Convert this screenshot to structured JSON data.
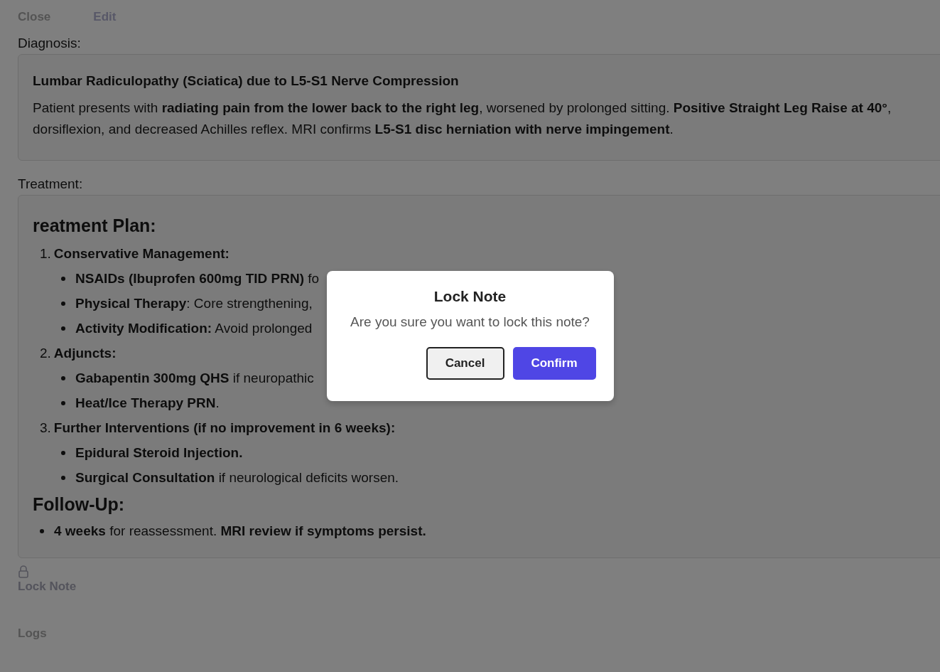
{
  "top_actions": [
    {
      "kind": "close",
      "label": "Close"
    },
    {
      "kind": "edit",
      "label": "Edit"
    }
  ],
  "diagnosis": {
    "label": "Diagnosis:",
    "title": "Lumbar Radiculopathy (Sciatica) due to L5-S1 Nerve Compression",
    "lines": [
      "Patient presents with **radiating pain from the lower back to the right leg**, worsened by prolonged sitting. **Positive Straight Leg Raise at 40°**,",
      "dorsiflexion, and decreased Achilles reflex. MRI confirms **L5-S1 disc herniation with nerve impingement**."
    ]
  },
  "treatment": {
    "label": "Treatment:",
    "blocks": [
      {
        "kind": "heading",
        "text": "reatment Plan:"
      },
      {
        "kind": "numbered",
        "number": "1.",
        "text": "Conservative Management:",
        "children": [
          {
            "text": "**NSAIDs (Ibuprofen 600mg TID PRN)** fo"
          },
          {
            "text": "**Physical Therapy**: Core strengthening,"
          },
          {
            "text": "**Activity Modification:** Avoid prolonged"
          }
        ]
      },
      {
        "kind": "numbered",
        "number": "2.",
        "text": "Adjuncts:",
        "children": [
          {
            "text": "**Gabapentin 300mg QHS** if neuropathic"
          },
          {
            "text": "**Heat/Ice Therapy PRN**."
          }
        ]
      },
      {
        "kind": "numbered",
        "number": "3.",
        "text": "Further Interventions (if no improvement in 6 weeks):",
        "children": [
          {
            "text": "**Epidural Steroid Injection.**"
          },
          {
            "text": "**Surgical Consultation** if neurological deficits worsen."
          }
        ]
      },
      {
        "kind": "heading",
        "text": "Follow-Up:"
      },
      {
        "kind": "bullet",
        "text": "**4 weeks** for reassessment. **MRI review if symptoms persist.**"
      }
    ]
  },
  "lock_action": {
    "label": "Lock Note"
  },
  "logs": {
    "label": "Logs"
  },
  "dialog": {
    "title": "Lock Note",
    "message": "Are you sure you want to lock this note?",
    "buttons": [
      {
        "kind": "cancel",
        "label": "Cancel"
      },
      {
        "kind": "confirm",
        "label": "Confirm"
      }
    ]
  }
}
